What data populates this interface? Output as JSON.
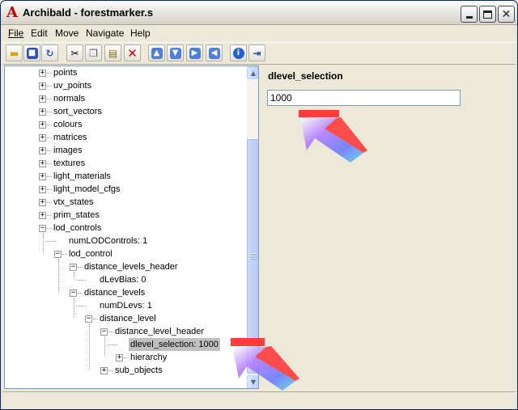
{
  "window": {
    "title": "Archibald - forestmarker.s",
    "app_icon": "A"
  },
  "menu": [
    {
      "label": "File"
    },
    {
      "label": "Edit"
    },
    {
      "label": "Move"
    },
    {
      "label": "Navigate"
    },
    {
      "label": "Help"
    }
  ],
  "toolbar": {
    "buttons": [
      "open-icon",
      "save-icon",
      "refresh-icon",
      "cut-icon",
      "copy-icon",
      "paste-icon",
      "delete-icon",
      "move-up-icon",
      "move-down-icon",
      "move-right-icon",
      "move-left-icon",
      "info-icon",
      "exit-icon"
    ]
  },
  "tree": {
    "items": [
      {
        "label": "points",
        "toggle": "+"
      },
      {
        "label": "uv_points",
        "toggle": "+"
      },
      {
        "label": "normals",
        "toggle": "+"
      },
      {
        "label": "sort_vectors",
        "toggle": "+"
      },
      {
        "label": "colours",
        "toggle": "+"
      },
      {
        "label": "matrices",
        "toggle": "+"
      },
      {
        "label": "images",
        "toggle": "+"
      },
      {
        "label": "textures",
        "toggle": "+"
      },
      {
        "label": "light_materials",
        "toggle": "+"
      },
      {
        "label": "light_model_cfgs",
        "toggle": "+"
      },
      {
        "label": "vtx_states",
        "toggle": "+"
      },
      {
        "label": "prim_states",
        "toggle": "+"
      },
      {
        "label": "lod_controls",
        "toggle": "-"
      },
      {
        "label": "numLODControls: 1",
        "toggle": ""
      },
      {
        "label": "lod_control",
        "toggle": "-"
      },
      {
        "label": "distance_levels_header",
        "toggle": "-"
      },
      {
        "label": "dLevBias: 0",
        "toggle": ""
      },
      {
        "label": "distance_levels",
        "toggle": "-"
      },
      {
        "label": "numDLevs: 1",
        "toggle": ""
      },
      {
        "label": "distance_level",
        "toggle": "-"
      },
      {
        "label": "distance_level_header",
        "toggle": "-"
      },
      {
        "label": "dlevel_selection: 1000",
        "toggle": ""
      },
      {
        "label": "hierarchy",
        "toggle": "+"
      },
      {
        "label": "sub_objects",
        "toggle": "+"
      }
    ],
    "selected": "dlevel_selection: 1000"
  },
  "editor": {
    "field_label": "dlevel_selection",
    "field_value": "1000"
  },
  "colors": {
    "title_text": "#000000",
    "app_icon": "#c00000",
    "selection_bg": "#c0c0c0",
    "arrow_red": "#ff3b3b",
    "arrow_purple": "#8a5cff",
    "arrow_cyan": "#5fd6e8"
  }
}
